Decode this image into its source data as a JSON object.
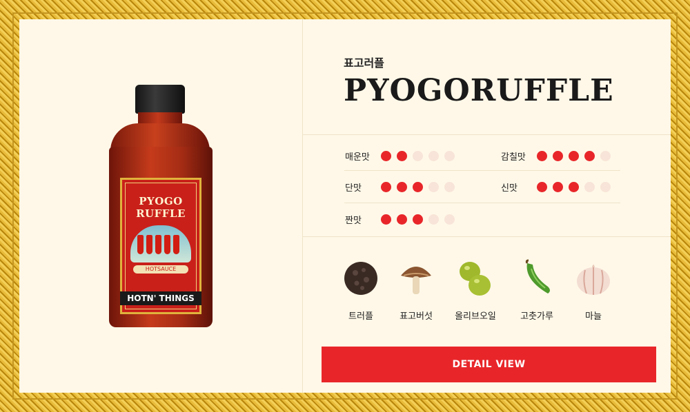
{
  "product": {
    "name_ko": "표고러플",
    "name_en": "PYOGORUFFLE",
    "label": {
      "line1": "PYOGO",
      "line2": "RUFFLE",
      "sauce": "HOTSAUCE",
      "brand": "HOTN' THINGS"
    }
  },
  "tastes": [
    {
      "label": "매운맛",
      "level": 2,
      "max": 5
    },
    {
      "label": "감칠맛",
      "level": 4,
      "max": 5
    },
    {
      "label": "단맛",
      "level": 3,
      "max": 5
    },
    {
      "label": "신맛",
      "level": 3,
      "max": 5
    },
    {
      "label": "짠맛",
      "level": 3,
      "max": 5
    }
  ],
  "ingredients": [
    {
      "label": "트러플",
      "icon": "truffle-icon"
    },
    {
      "label": "표고버섯",
      "icon": "shiitake-mushroom-icon"
    },
    {
      "label": "올리브오일",
      "icon": "olive-icon"
    },
    {
      "label": "고춧가루",
      "icon": "green-chili-icon"
    },
    {
      "label": "마늘",
      "icon": "garlic-icon"
    }
  ],
  "detail_button": "DETAIL VIEW",
  "colors": {
    "accent": "#e8262a",
    "dot_off": "#f8e4d8",
    "card_bg": "#fff8e8",
    "frame_gold": "#d9a92a"
  }
}
